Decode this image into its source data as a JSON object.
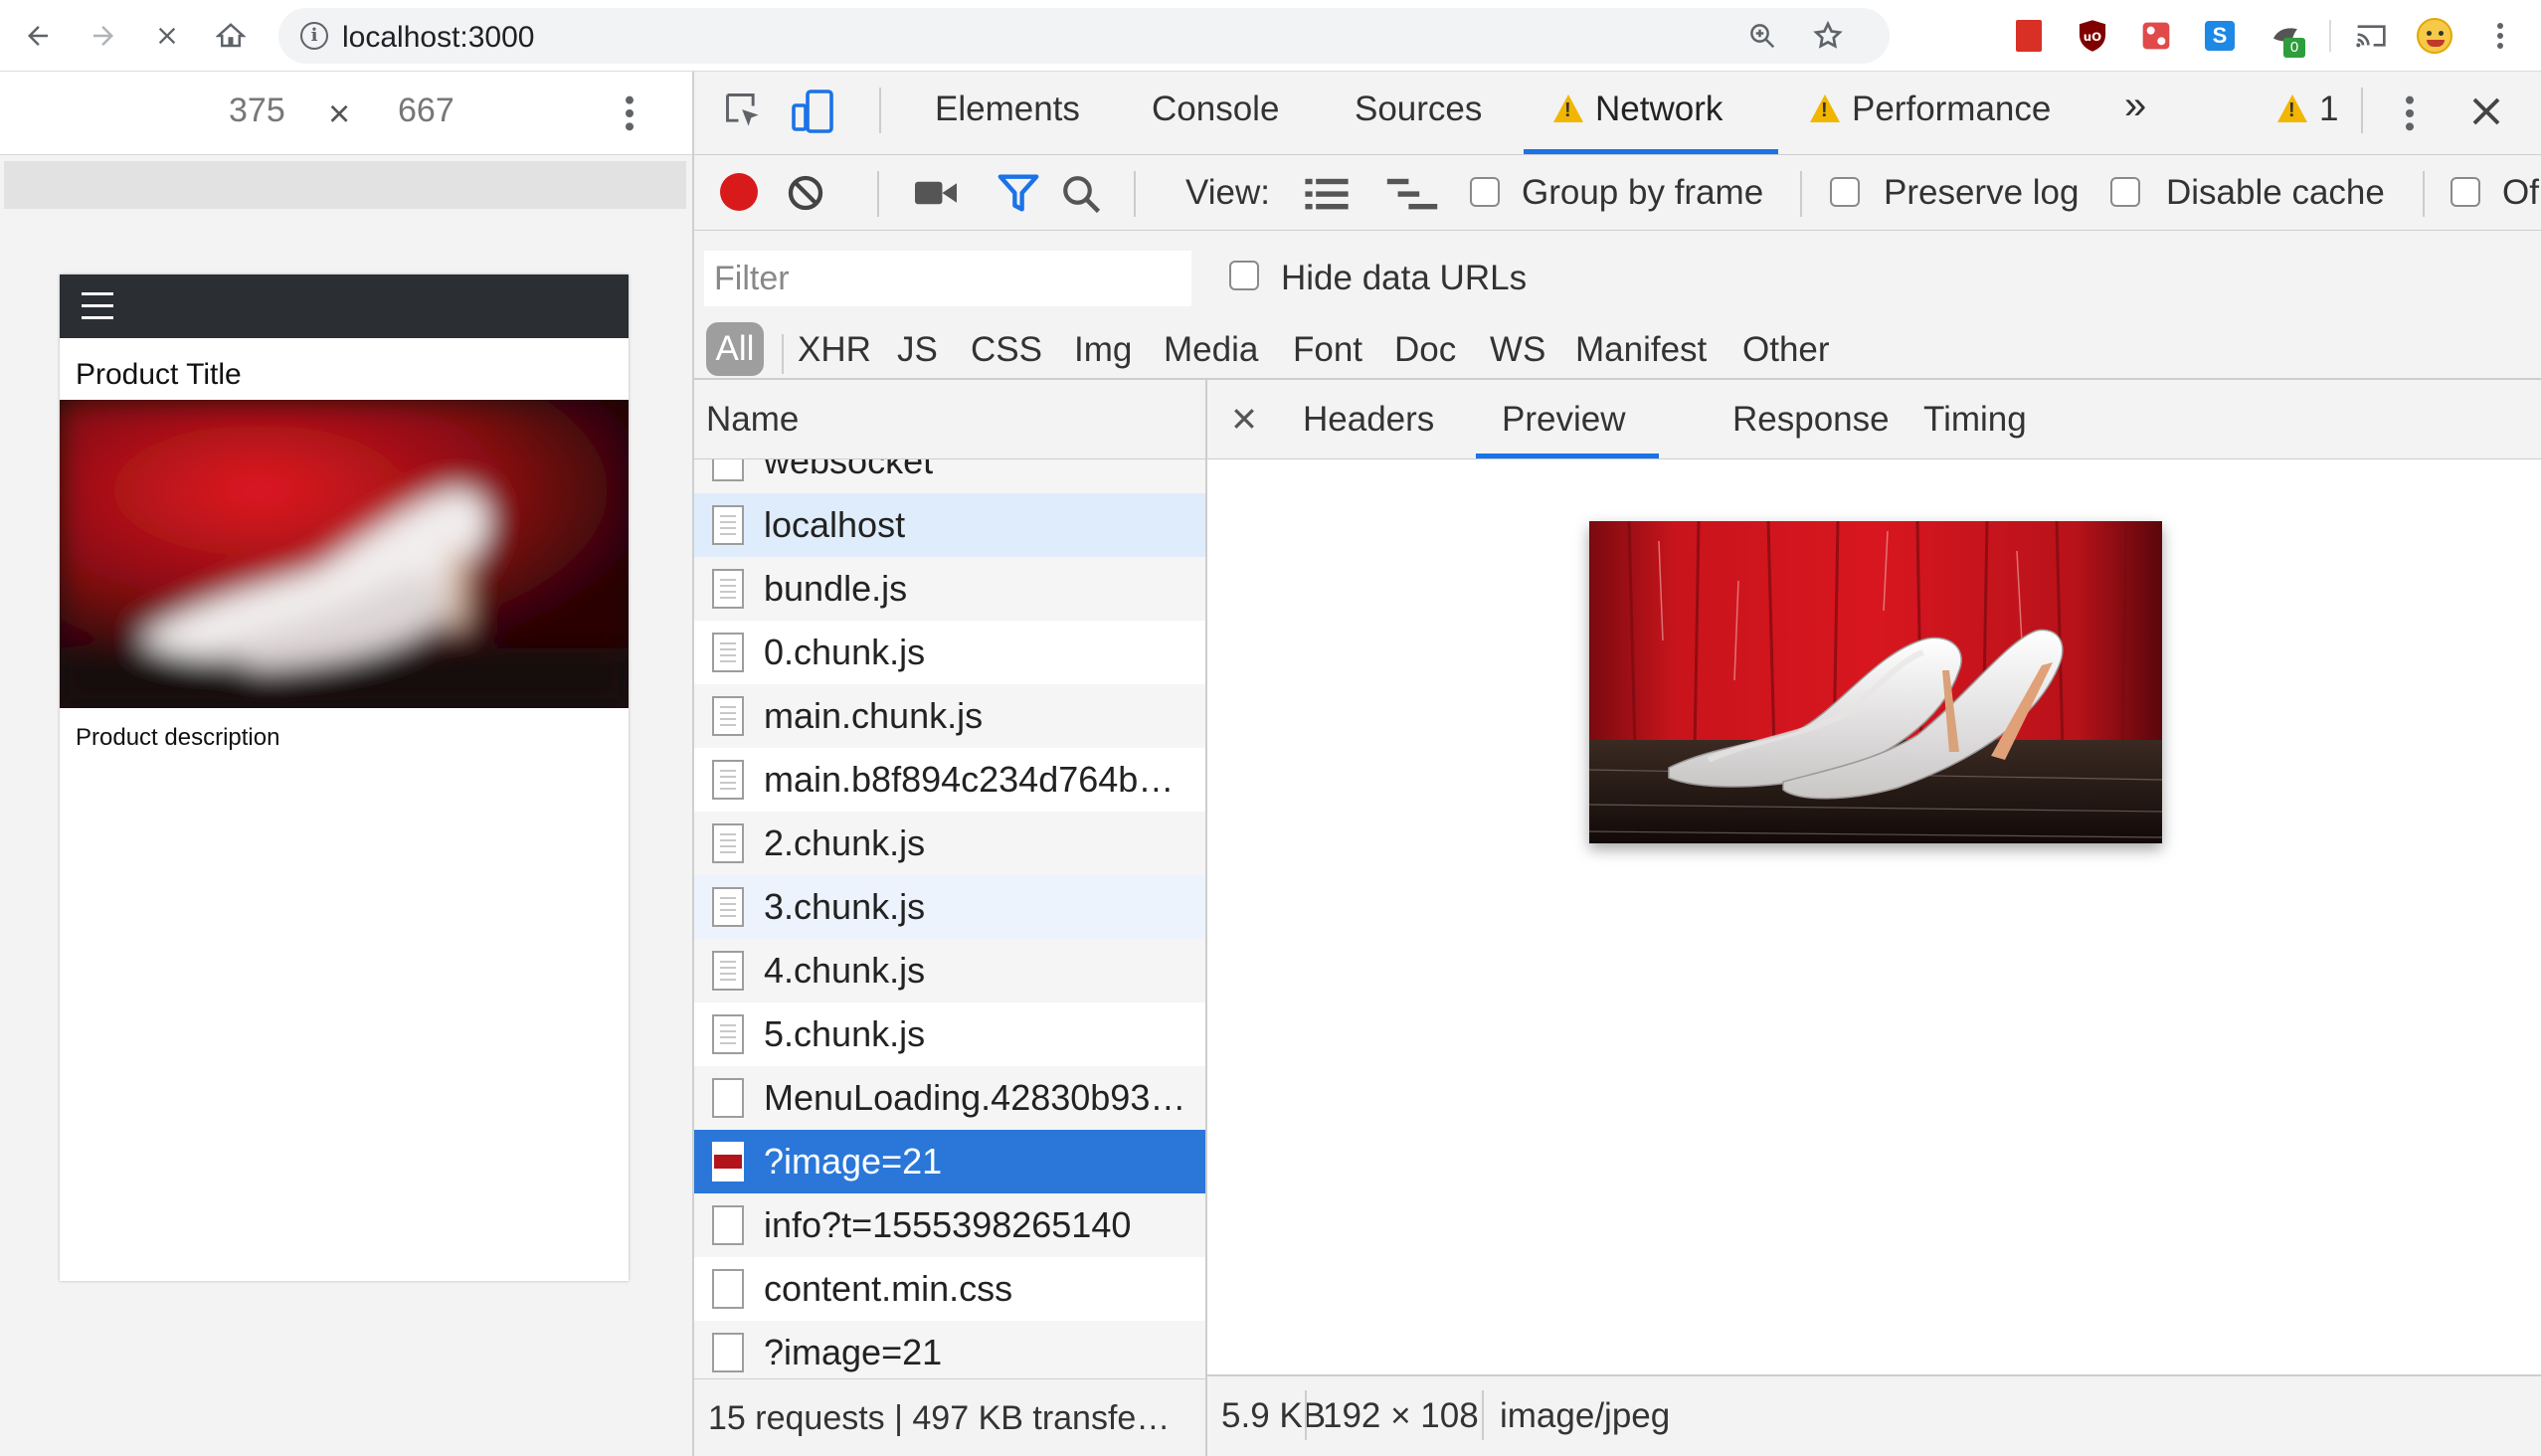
{
  "browser": {
    "url": "localhost:3000",
    "extension_badge": "0"
  },
  "device": {
    "width": "375",
    "times": "×",
    "height": "667"
  },
  "app": {
    "product_title": "Product Title",
    "product_description": "Product description"
  },
  "devtools": {
    "tabs": [
      "Elements",
      "Console",
      "Sources",
      "Network",
      "Performance"
    ],
    "more_tabs": "»",
    "warning_count": "1",
    "toolbar": {
      "view_label": "View:",
      "group_by_frame": "Group by frame",
      "preserve_log": "Preserve log",
      "disable_cache": "Disable cache",
      "offline_truncated": "Of"
    },
    "filter": {
      "placeholder": "Filter",
      "hide_data_urls": "Hide data URLs"
    },
    "types": [
      "All",
      "XHR",
      "JS",
      "CSS",
      "Img",
      "Media",
      "Font",
      "Doc",
      "WS",
      "Manifest",
      "Other"
    ],
    "name_header": "Name",
    "requests": [
      {
        "name": "websocket",
        "icon": "blank"
      },
      {
        "name": "localhost",
        "icon": "doc"
      },
      {
        "name": "bundle.js",
        "icon": "doc"
      },
      {
        "name": "0.chunk.js",
        "icon": "doc"
      },
      {
        "name": "main.chunk.js",
        "icon": "doc"
      },
      {
        "name": "main.b8f894c234d764b…",
        "icon": "doc"
      },
      {
        "name": "2.chunk.js",
        "icon": "doc"
      },
      {
        "name": "3.chunk.js",
        "icon": "doc"
      },
      {
        "name": "4.chunk.js",
        "icon": "doc"
      },
      {
        "name": "5.chunk.js",
        "icon": "doc"
      },
      {
        "name": "MenuLoading.42830b93…",
        "icon": "blank"
      },
      {
        "name": "?image=21",
        "icon": "img"
      },
      {
        "name": "info?t=1555398265140",
        "icon": "blank"
      },
      {
        "name": "content.min.css",
        "icon": "blank"
      },
      {
        "name": "?image=21",
        "icon": "blank"
      }
    ],
    "summary": "15 requests | 497 KB transfe…",
    "detail_tabs": [
      "Headers",
      "Preview",
      "Response",
      "Timing"
    ],
    "preview_info": {
      "size": "5.9 KB",
      "dimensions": "192 × 108",
      "mime": "image/jpeg"
    },
    "colors": {
      "accent": "#1a73e8",
      "selected_row": "#2a77d9",
      "record": "#d91a1a",
      "filter_icon": "#1a73e8"
    }
  }
}
